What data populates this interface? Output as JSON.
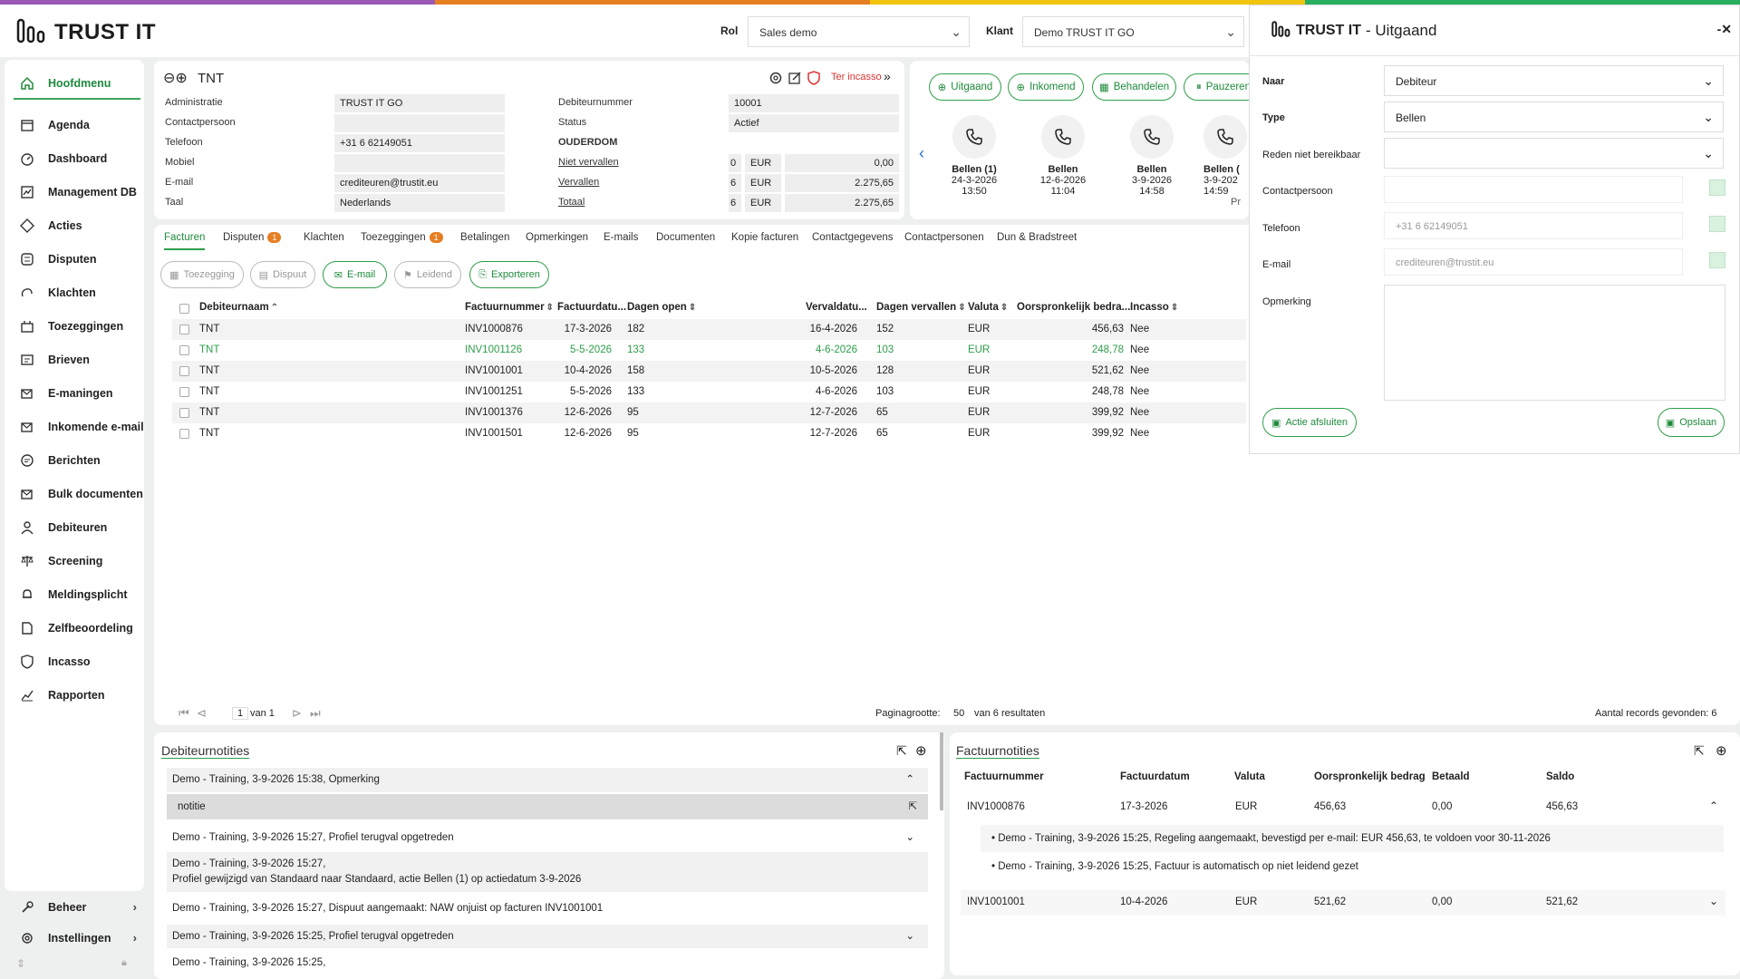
{
  "stripe_colors": [
    "#9b59b6",
    "#e67e22",
    "#f1c40f",
    "#27ae60"
  ],
  "accent": "#2e9e4a",
  "header": {
    "logo": "TRUST IT",
    "rol_label": "Rol",
    "rol_value": "Sales demo",
    "klant_label": "Klant",
    "klant_value": "Demo TRUST IT GO"
  },
  "sidebar": {
    "items": [
      {
        "label": "Hoofdmenu",
        "icon": "home-icon"
      },
      {
        "label": "Agenda",
        "icon": "calendar-icon"
      },
      {
        "label": "Dashboard",
        "icon": "dashboard-icon"
      },
      {
        "label": "Management DB",
        "icon": "chart-icon"
      },
      {
        "label": "Acties",
        "icon": "action-icon"
      },
      {
        "label": "Disputen",
        "icon": "dispute-icon"
      },
      {
        "label": "Klachten",
        "icon": "complaint-icon"
      },
      {
        "label": "Toezeggingen",
        "icon": "promise-icon"
      },
      {
        "label": "Brieven",
        "icon": "letter-icon"
      },
      {
        "label": "E-maningen",
        "icon": "email-out-icon"
      },
      {
        "label": "Inkomende e-mail",
        "icon": "email-in-icon"
      },
      {
        "label": "Berichten",
        "icon": "message-icon"
      },
      {
        "label": "Bulk documenten",
        "icon": "bulk-icon"
      },
      {
        "label": "Debiteuren",
        "icon": "person-icon"
      },
      {
        "label": "Screening",
        "icon": "scale-icon"
      },
      {
        "label": "Meldingsplicht",
        "icon": "bell-icon"
      },
      {
        "label": "Zelfbeoordeling",
        "icon": "document-icon"
      },
      {
        "label": "Incasso",
        "icon": "shield-icon"
      },
      {
        "label": "Rapporten",
        "icon": "report-icon"
      }
    ],
    "beheer": "Beheer",
    "instellingen": "Instellingen"
  },
  "debtor": {
    "name": "TNT",
    "ter_incasso": "Ter incasso",
    "left": [
      {
        "label": "Administratie",
        "value": "TRUST IT GO"
      },
      {
        "label": "Contactpersoon",
        "value": ""
      },
      {
        "label": "Telefoon",
        "value": "+31 6 62149051"
      },
      {
        "label": "Mobiel",
        "value": ""
      },
      {
        "label": "E-mail",
        "value": "crediteuren@trustit.eu"
      },
      {
        "label": "Taal",
        "value": "Nederlands"
      }
    ],
    "debiteurnummer_label": "Debiteurnummer",
    "debiteurnummer": "10001",
    "status_label": "Status",
    "status": "Actief",
    "ouderdom": "OUDERDOM",
    "aging": [
      {
        "label": "Niet vervallen",
        "count": "0",
        "cur": "EUR",
        "amount": "0,00"
      },
      {
        "label": "Vervallen",
        "count": "6",
        "cur": "EUR",
        "amount": "2.275,65"
      },
      {
        "label": "Totaal",
        "count": "6",
        "cur": "EUR",
        "amount": "2.275,65"
      }
    ]
  },
  "actions_panel": {
    "buttons": [
      "Uitgaand",
      "Inkomend",
      "Behandelen",
      "Pauzeren"
    ],
    "items": [
      {
        "title": "Bellen (1)",
        "date": "24-3-2026",
        "time": "13:50"
      },
      {
        "title": "Bellen",
        "date": "12-6-2026",
        "time": "11:04"
      },
      {
        "title": "Bellen",
        "date": "3-9-2026",
        "time": "14:58"
      },
      {
        "title": "Bellen (",
        "date": "3-9-202",
        "time": "14:59"
      }
    ],
    "extra": "Pr"
  },
  "tabs": [
    {
      "label": "Facturen",
      "badge": ""
    },
    {
      "label": "Disputen",
      "badge": "1"
    },
    {
      "label": "Klachten",
      "badge": ""
    },
    {
      "label": "Toezeggingen",
      "badge": "1"
    },
    {
      "label": "Betalingen",
      "badge": ""
    },
    {
      "label": "Opmerkingen",
      "badge": ""
    },
    {
      "label": "E-mails",
      "badge": ""
    },
    {
      "label": "Documenten",
      "badge": ""
    },
    {
      "label": "Kopie facturen",
      "badge": ""
    },
    {
      "label": "Contactgegevens",
      "badge": ""
    },
    {
      "label": "Contactpersonen",
      "badge": ""
    },
    {
      "label": "Dun & Bradstreet",
      "badge": ""
    }
  ],
  "toolbar": {
    "toezegging": "Toezegging",
    "dispuut": "Dispuut",
    "email": "E-mail",
    "leidend": "Leidend",
    "exporteren": "Exporteren"
  },
  "table": {
    "columns": [
      "Debiteurnaam",
      "Factuurnummer",
      "Factuurdatu...",
      "Dagen open",
      "Vervaldatu...",
      "Dagen vervallen",
      "Valuta",
      "Oorspronkelijk bedra...",
      "Incasso"
    ],
    "rows": [
      [
        "TNT",
        "INV1000876",
        "17-3-2026",
        "182",
        "16-4-2026",
        "152",
        "EUR",
        "456,63",
        "Nee"
      ],
      [
        "TNT",
        "INV1001126",
        "5-5-2026",
        "133",
        "4-6-2026",
        "103",
        "EUR",
        "248,78",
        "Nee"
      ],
      [
        "TNT",
        "INV1001001",
        "10-4-2026",
        "158",
        "10-5-2026",
        "128",
        "EUR",
        "521,62",
        "Nee"
      ],
      [
        "TNT",
        "INV1001251",
        "5-5-2026",
        "133",
        "4-6-2026",
        "103",
        "EUR",
        "248,78",
        "Nee"
      ],
      [
        "TNT",
        "INV1001376",
        "12-6-2026",
        "95",
        "12-7-2026",
        "65",
        "EUR",
        "399,92",
        "Nee"
      ],
      [
        "TNT",
        "INV1001501",
        "12-6-2026",
        "95",
        "12-7-2026",
        "65",
        "EUR",
        "399,92",
        "Nee"
      ]
    ],
    "highlight_row": 1
  },
  "pagination": {
    "page": "1",
    "of": "van 1",
    "size_label": "Paginagrootte:",
    "size": "50",
    "results": "van 6 resultaten",
    "records": "Aantal records gevonden: 6"
  },
  "debtor_notes": {
    "title": "Debiteurnotities",
    "items": [
      "Demo - Training, 3-9-2026 15:38, Opmerking",
      "notitie",
      "Demo - Training, 3-9-2026 15:27, Profiel terugval opgetreden",
      "Demo - Training, 3-9-2026 15:27,",
      "Profiel gewijzigd van Standaard naar Standaard, actie Bellen (1) op actiedatum 3-9-2026",
      "Demo - Training, 3-9-2026 15:27, Dispuut aangemaakt: NAW onjuist op facturen INV1001001",
      "Demo - Training, 3-9-2026 15:25, Profiel terugval opgetreden",
      "Demo - Training, 3-9-2026 15:25,"
    ]
  },
  "invoice_notes": {
    "title": "Factuurnotities",
    "columns": [
      "Factuurnummer",
      "Factuurdatum",
      "Valuta",
      "Oorspronkelijk bedrag",
      "Betaald",
      "Saldo"
    ],
    "rows": [
      {
        "cells": [
          "INV1000876",
          "17-3-2026",
          "EUR",
          "456,63",
          "0,00",
          "456,63"
        ],
        "notes": [
          "Demo - Training, 3-9-2026 15:25, Regeling aangemaakt, bevestigd per e-mail: EUR 456,63, te voldoen voor 30-11-2026",
          "Demo - Training, 3-9-2026 15:25, Factuur is automatisch op niet leidend gezet"
        ]
      },
      {
        "cells": [
          "INV1001001",
          "10-4-2026",
          "EUR",
          "521,62",
          "0,00",
          "521,62"
        ],
        "notes": []
      }
    ]
  },
  "drawer": {
    "logo": "TRUST IT",
    "title": "- Uitgaand",
    "naar_label": "Naar",
    "naar_value": "Debiteur",
    "type_label": "Type",
    "type_value": "Bellen",
    "reden_label": "Reden niet bereikbaar",
    "reden_value": "",
    "contact_label": "Contactpersoon",
    "telefoon_label": "Telefoon",
    "telefoon_placeholder": "+31 6 62149051",
    "email_label": "E-mail",
    "email_placeholder": "crediteuren@trustit.eu",
    "opmerking_label": "Opmerking",
    "actie_afsluiten": "Actie afsluiten",
    "opslaan": "Opslaan"
  }
}
